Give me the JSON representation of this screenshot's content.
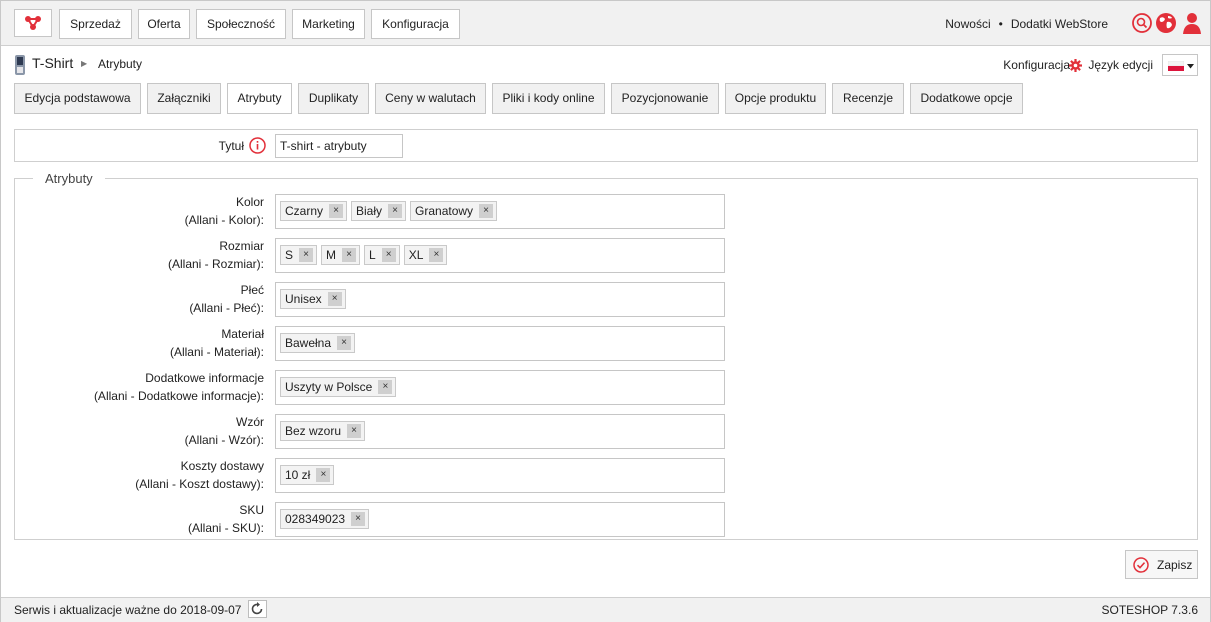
{
  "nav": {
    "logo_icon": "soteshop-logo-icon",
    "buttons": [
      "Sprzedaż",
      "Oferta",
      "Społeczność",
      "Marketing",
      "Konfiguracja"
    ],
    "links": [
      "Nowości",
      "Dodatki WebStore"
    ],
    "link_separator": "•",
    "icons": [
      "search-icon",
      "globe-icon",
      "user-icon"
    ],
    "accent": "#e2303a"
  },
  "breadcrumb": {
    "product": "T-Shirt",
    "separator": "▶",
    "page": "Atrybuty"
  },
  "tools": {
    "config_label": "Konfiguracja",
    "language_label": "Język edycji",
    "language_flag": "flag-poland-icon"
  },
  "tabs": [
    "Edycja podstawowa",
    "Załączniki",
    "Atrybuty",
    "Duplikaty",
    "Ceny w walutach",
    "Pliki i kody online",
    "Pozycjonowanie",
    "Opcje produktu",
    "Recenzje",
    "Dodatkowe opcje"
  ],
  "active_tab": "Atrybuty",
  "title_field": {
    "label": "Tytuł",
    "value": "T-shirt - atrybuty"
  },
  "attributes": {
    "legend": "Atrybuty",
    "rows": [
      {
        "label": "Kolor",
        "sub": "(Allani - Kolor):",
        "tags": [
          "Czarny",
          "Biały",
          "Granatowy"
        ]
      },
      {
        "label": "Rozmiar",
        "sub": "(Allani - Rozmiar):",
        "tags": [
          "S",
          "M",
          "L",
          "XL"
        ]
      },
      {
        "label": "Płeć",
        "sub": "(Allani - Płeć):",
        "tags": [
          "Unisex"
        ]
      },
      {
        "label": "Materiał",
        "sub": "(Allani - Materiał):",
        "tags": [
          "Bawełna"
        ]
      },
      {
        "label": "Dodatkowe informacje",
        "sub": "(Allani - Dodatkowe informacje):",
        "tags": [
          "Uszyty w Polsce"
        ]
      },
      {
        "label": "Wzór",
        "sub": "(Allani - Wzór):",
        "tags": [
          "Bez wzoru"
        ]
      },
      {
        "label": "Koszty dostawy",
        "sub": "(Allani - Koszt dostawy):",
        "tags": [
          "10 zł"
        ]
      },
      {
        "label": "SKU",
        "sub": "(Allani - SKU):",
        "tags": [
          "028349023"
        ]
      }
    ],
    "remove_glyph": "×"
  },
  "save_label": "Zapisz",
  "footer": {
    "service": "Serwis i aktualizacje ważne do 2018-09-07",
    "version": "SOTESHOP 7.3.6"
  }
}
